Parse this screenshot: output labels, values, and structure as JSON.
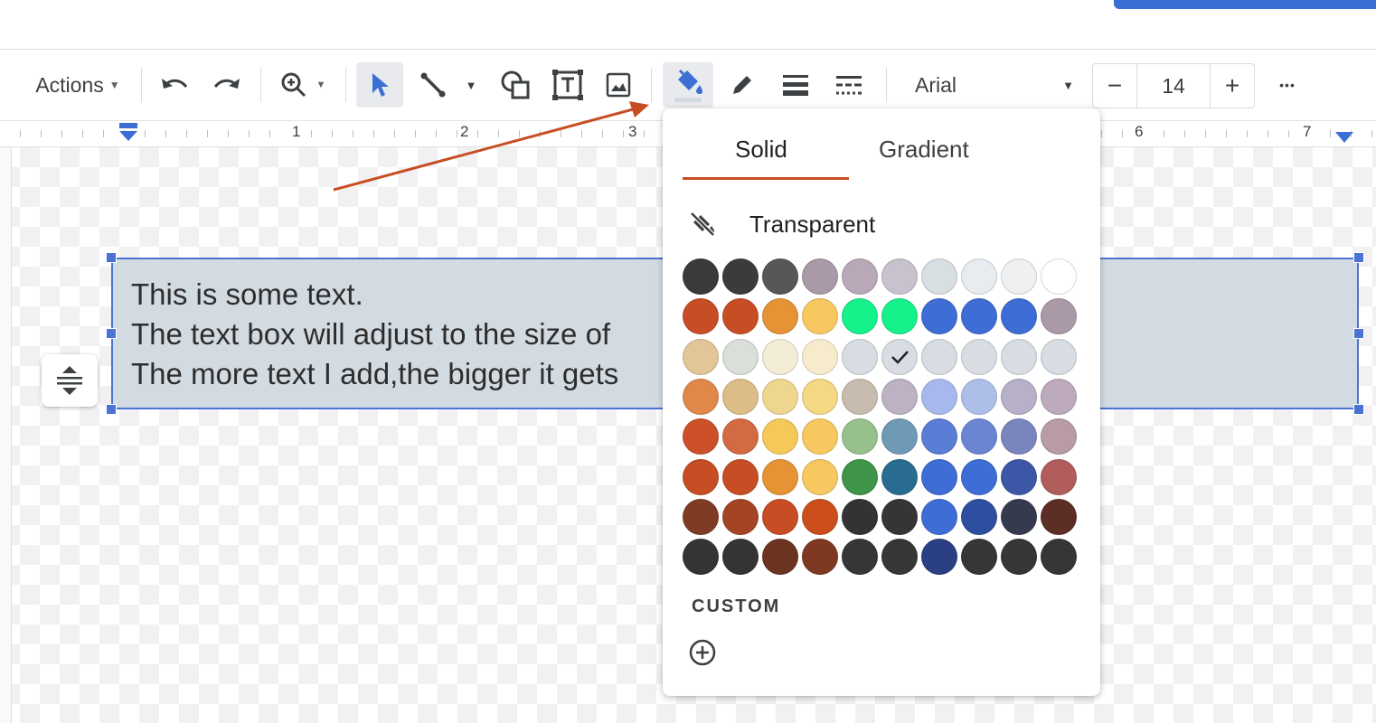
{
  "toolbar": {
    "actions_label": "Actions",
    "font_name": "Arial",
    "font_size": "14",
    "decrease_label": "−",
    "increase_label": "+",
    "more_label": "•••"
  },
  "ruler": {
    "numbers": [
      "1",
      "2",
      "3",
      "6",
      "7"
    ]
  },
  "textbox": {
    "lines": [
      "This is some text.",
      "The text box will adjust to the size of",
      "The more text I add,the bigger it gets"
    ]
  },
  "fill_popup": {
    "tabs": [
      "Solid",
      "Gradient"
    ],
    "active_tab": "Solid",
    "transparent_label": "Transparent",
    "custom_label": "CUSTOM",
    "selected_swatch": "row 3, column 6",
    "palette": [
      [
        "#3a3a3a",
        "#3b3b3b",
        "#575757",
        "#aa9aa8",
        "#b9a9b8",
        "#c7c2cd",
        "#d8dfe3",
        "#e7ecf0",
        "#eef0f2",
        "#ffffff"
      ],
      [
        "#c74d24",
        "#c74d24",
        "#e59334",
        "#f6c85f",
        "#15f28c",
        "#15f28c",
        "#3f6dd6",
        "#3f6dd6",
        "#3f6dd6",
        "#aa9aa8"
      ],
      [
        "#e2c699",
        "#dadfd9",
        "#f3ecd6",
        "#f6eccc",
        "#d7dde2",
        "#d7dde2",
        "#d7dde2",
        "#d7dde2",
        "#d7dde2",
        "#d7dde2"
      ],
      [
        "#e0884a",
        "#dcbd87",
        "#efd68f",
        "#f5d883",
        "#c7bcaf",
        "#bdb2c3",
        "#a7b9ec",
        "#adbfe8",
        "#b7b0c8",
        "#bdabbd"
      ],
      [
        "#cc5128",
        "#d36a42",
        "#f5c85a",
        "#f6c85f",
        "#97c08c",
        "#6f9ab5",
        "#5a7dd6",
        "#6a86d2",
        "#7a85bd",
        "#b89ba6"
      ],
      [
        "#c74d24",
        "#c74d24",
        "#e59334",
        "#f6c85f",
        "#3e9448",
        "#286d90",
        "#3f6dd6",
        "#3f6dd6",
        "#3c57a5",
        "#b15d5b"
      ],
      [
        "#7f3b24",
        "#a44424",
        "#c74d24",
        "#cc4e1c",
        "#333333",
        "#353535",
        "#3f6dd6",
        "#2e4fa0",
        "#353a4f",
        "#5d2e25"
      ],
      [
        "#363333",
        "#363333",
        "#6a3421",
        "#7f3822",
        "#363636",
        "#363636",
        "#2b4084",
        "#363636",
        "#363636",
        "#363636"
      ]
    ]
  },
  "colors": {
    "accent_blue": "#4b73d4",
    "textbox_fill": "#d3dbe2",
    "annotation_arrow": "#c74d24"
  }
}
